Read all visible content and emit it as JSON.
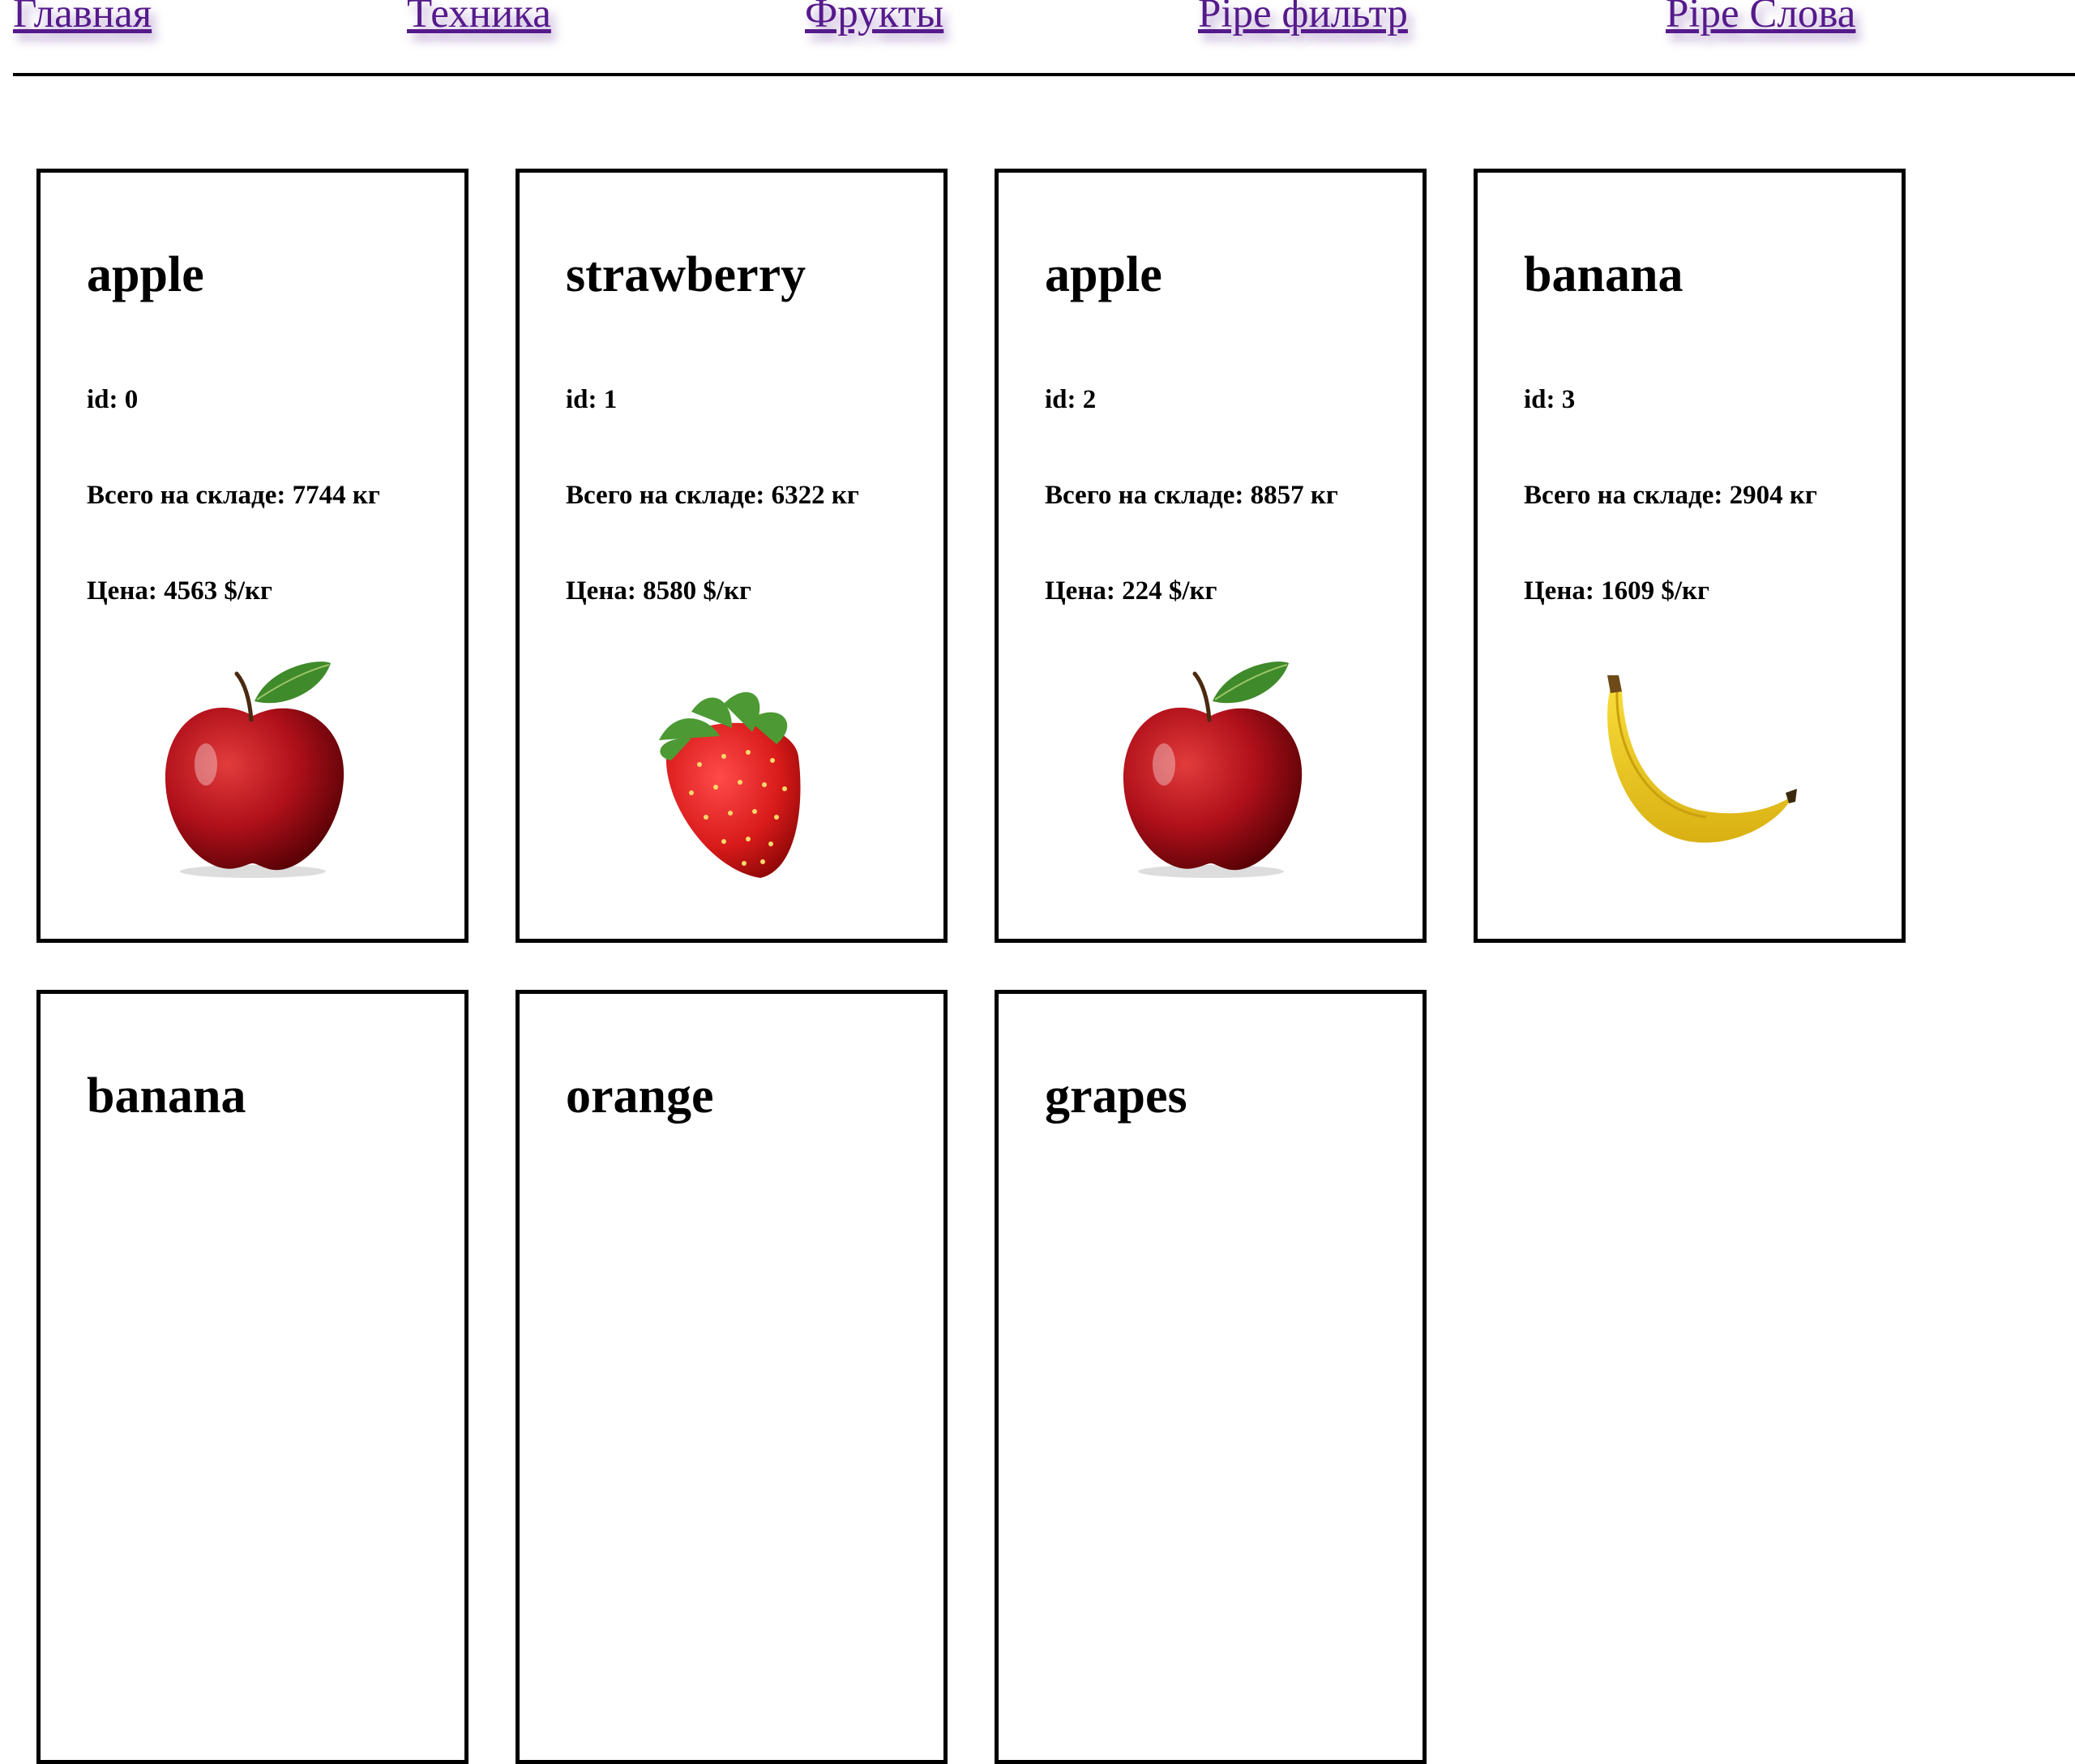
{
  "nav": {
    "items": [
      "Главная",
      "Техника",
      "Фрукты",
      "Pipe фильтр",
      "Pipe Слова"
    ]
  },
  "labels": {
    "id_prefix": "id: ",
    "stock_prefix": "Всего на складе: ",
    "stock_unit": " кг",
    "price_prefix": "Цена: ",
    "price_unit": " $/кг"
  },
  "products": [
    {
      "name": "apple",
      "id": "0",
      "stock": "7744",
      "price": "4563",
      "image": "apple-image"
    },
    {
      "name": "strawberry",
      "id": "1",
      "stock": "6322",
      "price": "8580",
      "image": "strawberry-image"
    },
    {
      "name": "apple",
      "id": "2",
      "stock": "8857",
      "price": "224",
      "image": "apple-image"
    },
    {
      "name": "banana",
      "id": "3",
      "stock": "2904",
      "price": "1609",
      "image": "banana-image"
    },
    {
      "name": "banana"
    },
    {
      "name": "orange"
    },
    {
      "name": "grapes"
    }
  ],
  "colors": {
    "link": "#551a8b",
    "border": "#000000"
  }
}
